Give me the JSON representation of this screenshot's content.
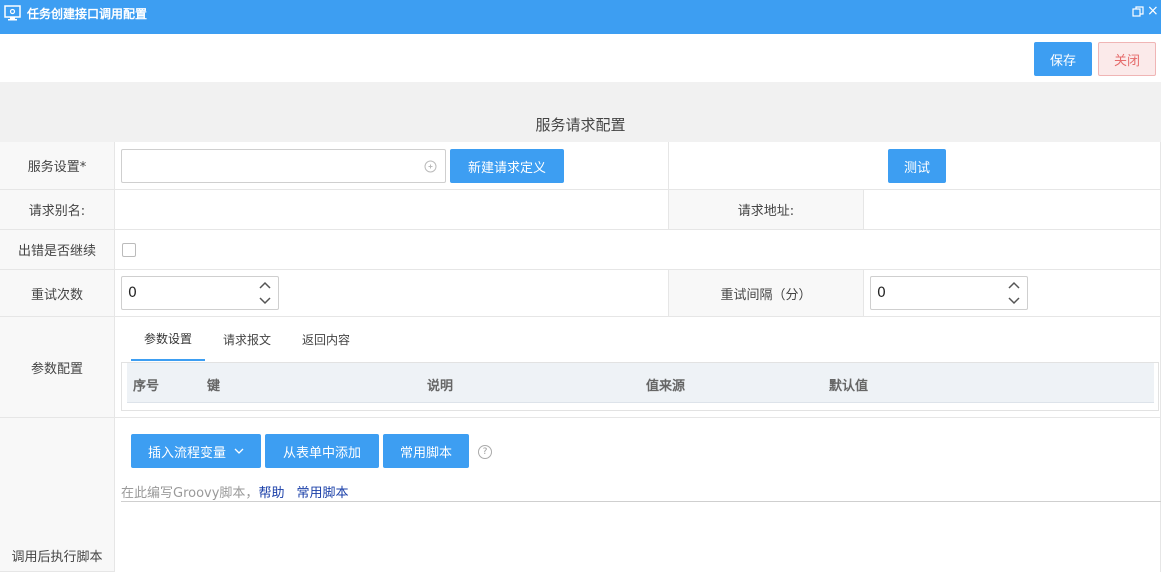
{
  "window": {
    "title": "任务创建接口调用配置",
    "restore_icon": "restore-icon",
    "close_glyph": "×"
  },
  "toolbar": {
    "save_label": "保存",
    "close_label": "关闭"
  },
  "section": {
    "title": "服务请求配置"
  },
  "form": {
    "service_label": "服务设置*",
    "service_input_value": "",
    "new_request_label": "新建请求定义",
    "test_label": "测试",
    "alias_label": "请求别名:",
    "alias_value": "",
    "url_label": "请求地址:",
    "url_value": "",
    "continue_on_error_label": "出错是否继续",
    "continue_on_error_checked": false,
    "retry_count_label": "重试次数",
    "retry_count_value": "0",
    "retry_interval_label": "重试间隔（分）",
    "retry_interval_value": "0",
    "param_config_label": "参数配置",
    "script_label": "调用后执行脚本"
  },
  "tabs": [
    {
      "label": "参数设置",
      "active": true
    },
    {
      "label": "请求报文",
      "active": false
    },
    {
      "label": "返回内容",
      "active": false
    }
  ],
  "param_table": {
    "columns": [
      "序号",
      "键",
      "说明",
      "值来源",
      "默认值"
    ],
    "rows": []
  },
  "script_toolbar": {
    "insert_var_label": "插入流程变量",
    "add_from_form_label": "从表单中添加",
    "common_script_label": "常用脚本"
  },
  "script_editor": {
    "placeholder_prefix": "在此编写Groovy脚本，",
    "help_link": "帮助",
    "common_script_link": "常用脚本"
  },
  "colors": {
    "primary": "#3d9ef2",
    "close_text": "#e56b6b",
    "link": "#1a3fa8"
  }
}
